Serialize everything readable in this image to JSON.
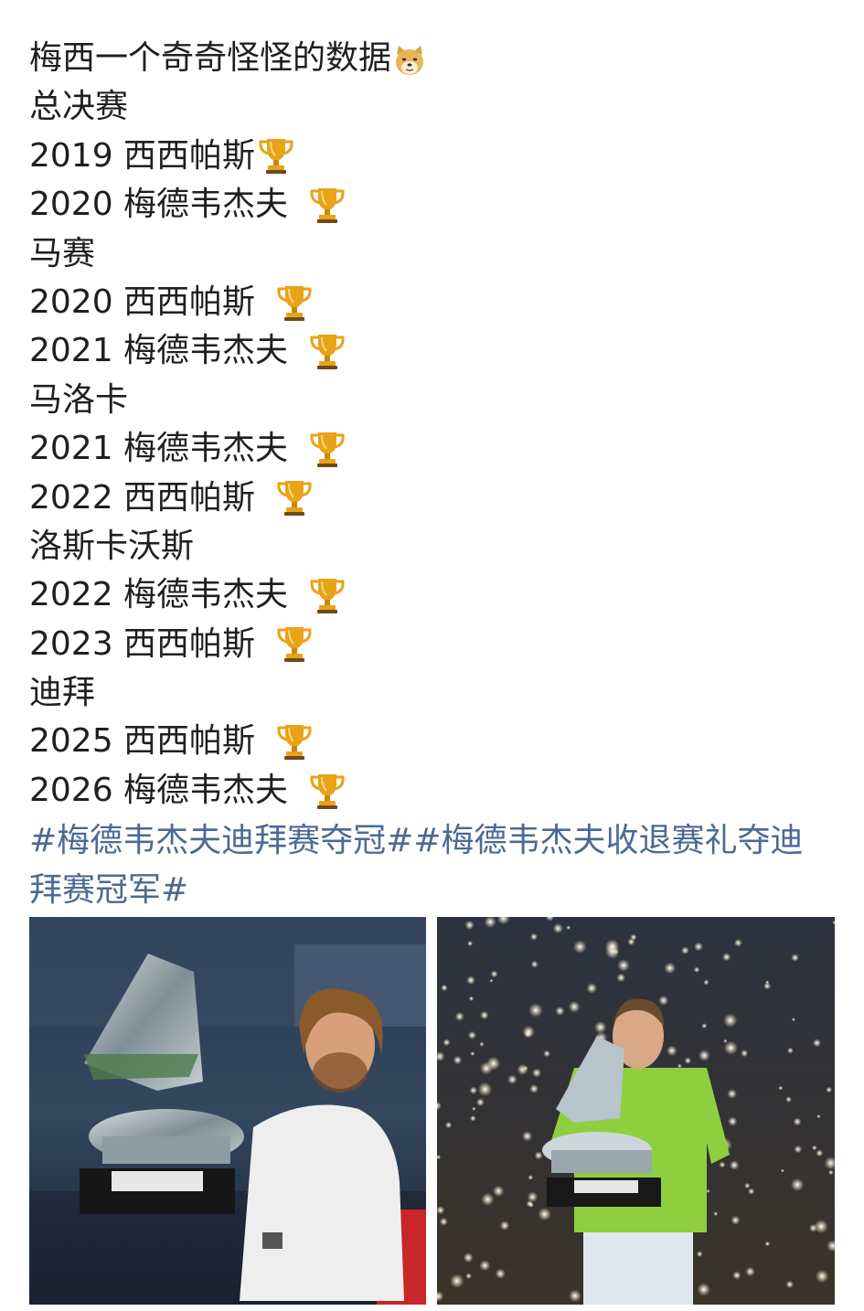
{
  "post": {
    "lines": [
      {
        "text": "梅西一个奇奇怪怪的数据",
        "emoji": "doge-icon"
      },
      {
        "text": "总决赛"
      },
      {
        "text": "2019 西西帕斯",
        "emoji": "trophy-icon"
      },
      {
        "text": "2020 梅德韦杰夫 ",
        "emoji": "trophy-icon"
      },
      {
        "text": "马赛"
      },
      {
        "text": "2020 西西帕斯 ",
        "emoji": "trophy-icon"
      },
      {
        "text": "2021 梅德韦杰夫 ",
        "emoji": "trophy-icon"
      },
      {
        "text": "马洛卡"
      },
      {
        "text": "2021 梅德韦杰夫 ",
        "emoji": "trophy-icon"
      },
      {
        "text": "2022 西西帕斯 ",
        "emoji": "trophy-icon"
      },
      {
        "text": "洛斯卡沃斯"
      },
      {
        "text": "2022 梅德韦杰夫 ",
        "emoji": "trophy-icon"
      },
      {
        "text": "2023 西西帕斯 ",
        "emoji": "trophy-icon"
      },
      {
        "text": "迪拜"
      },
      {
        "text": "2025 西西帕斯 ",
        "emoji": "trophy-icon"
      },
      {
        "text": "2026 梅德韦杰夫 ",
        "emoji": "trophy-icon"
      }
    ],
    "hashtags": [
      "#梅德韦杰夫迪拜赛夺冠#",
      "#梅德韦杰夫收退赛礼夺迪拜赛冠军#"
    ]
  },
  "colors": {
    "hashtag": "#4b6a94",
    "text": "#1f1f1f",
    "trophy_gold": "#e8a317"
  },
  "images": [
    {
      "name": "tsitsipas-trophy-photo"
    },
    {
      "name": "medvedev-trophy-photo"
    }
  ]
}
